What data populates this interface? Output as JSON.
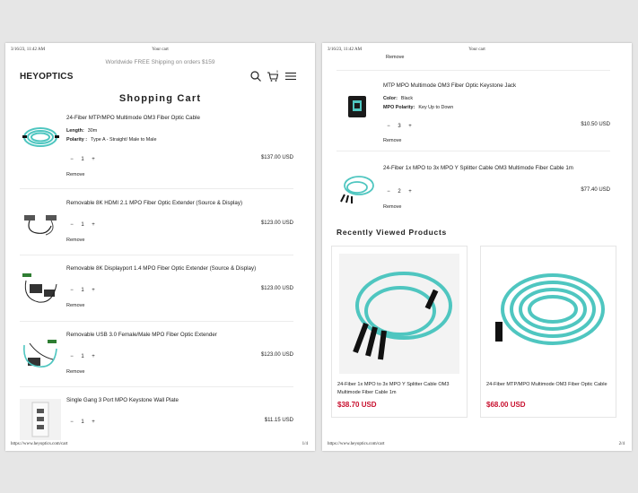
{
  "print": {
    "datetime": "3/16/23, 11:42 AM",
    "doc_title": "Your cart",
    "url": "https://www.heyoptics.com/cart",
    "page_left": "1/4",
    "page_right": "2/4"
  },
  "header": {
    "shipping_notice": "Worldwide FREE Shipping on orders $159",
    "brand": "HEYOPTICS",
    "cart_count": "0",
    "icons": [
      "search-icon",
      "cart-icon",
      "menu-icon"
    ]
  },
  "cart": {
    "title": "Shopping Cart",
    "remove_label": "Remove",
    "items": [
      {
        "title": "24-Fiber MTP/MPO Multimode OM3 Fiber Optic Cable",
        "attr1_label": "Length:",
        "attr1_value": "30m",
        "attr2_label": "Polarity :",
        "attr2_value": "Type A - Straight/ Male to Male",
        "qty": "1",
        "price": "$137.00 USD"
      },
      {
        "title": "Removable 8K HDMI 2.1 MPO Fiber Optic Extender (Source & Display)",
        "qty": "1",
        "price": "$123.00 USD"
      },
      {
        "title": "Removable 8K Displayport 1.4 MPO Fiber Optic Extender (Source & Display)",
        "qty": "1",
        "price": "$123.00 USD"
      },
      {
        "title": "Removable USB 3.0 Female/Male MPO Fiber Optic Extender",
        "qty": "1",
        "price": "$123.00 USD"
      },
      {
        "title": "Single Gang 3 Port MPO Keystone Wall Plate",
        "qty": "1",
        "price": "$11.15 USD"
      },
      {
        "title": "MTP MPO Multimode OM3 Fiber Optic Keystone Jack",
        "attr1_label": "Color:",
        "attr1_value": "Black",
        "attr2_label": "MPO Polarity:",
        "attr2_value": "Key Up to Down",
        "qty": "3",
        "price": "$10.50 USD"
      },
      {
        "title": "24-Fiber 1x MPO to 3x MPO Y Splitter Cable OM3 Multimode Fiber Cable 1m",
        "qty": "2",
        "price": "$77.40 USD"
      }
    ]
  },
  "recently_viewed": {
    "title": "Recently Viewed Products",
    "products": [
      {
        "name": "24-Fiber 1x MPO to 3x MPO Y Splitter Cable OM3 Multimode Fiber Cable 1m",
        "price": "$38.70 USD"
      },
      {
        "name": "24-Fiber MTP/MPO Multimode OM3 Fiber Optic Cable",
        "price": "$68.00 USD"
      }
    ]
  },
  "colors": {
    "accent_price": "#c8102e",
    "cable_aqua": "#4fc6c0"
  }
}
